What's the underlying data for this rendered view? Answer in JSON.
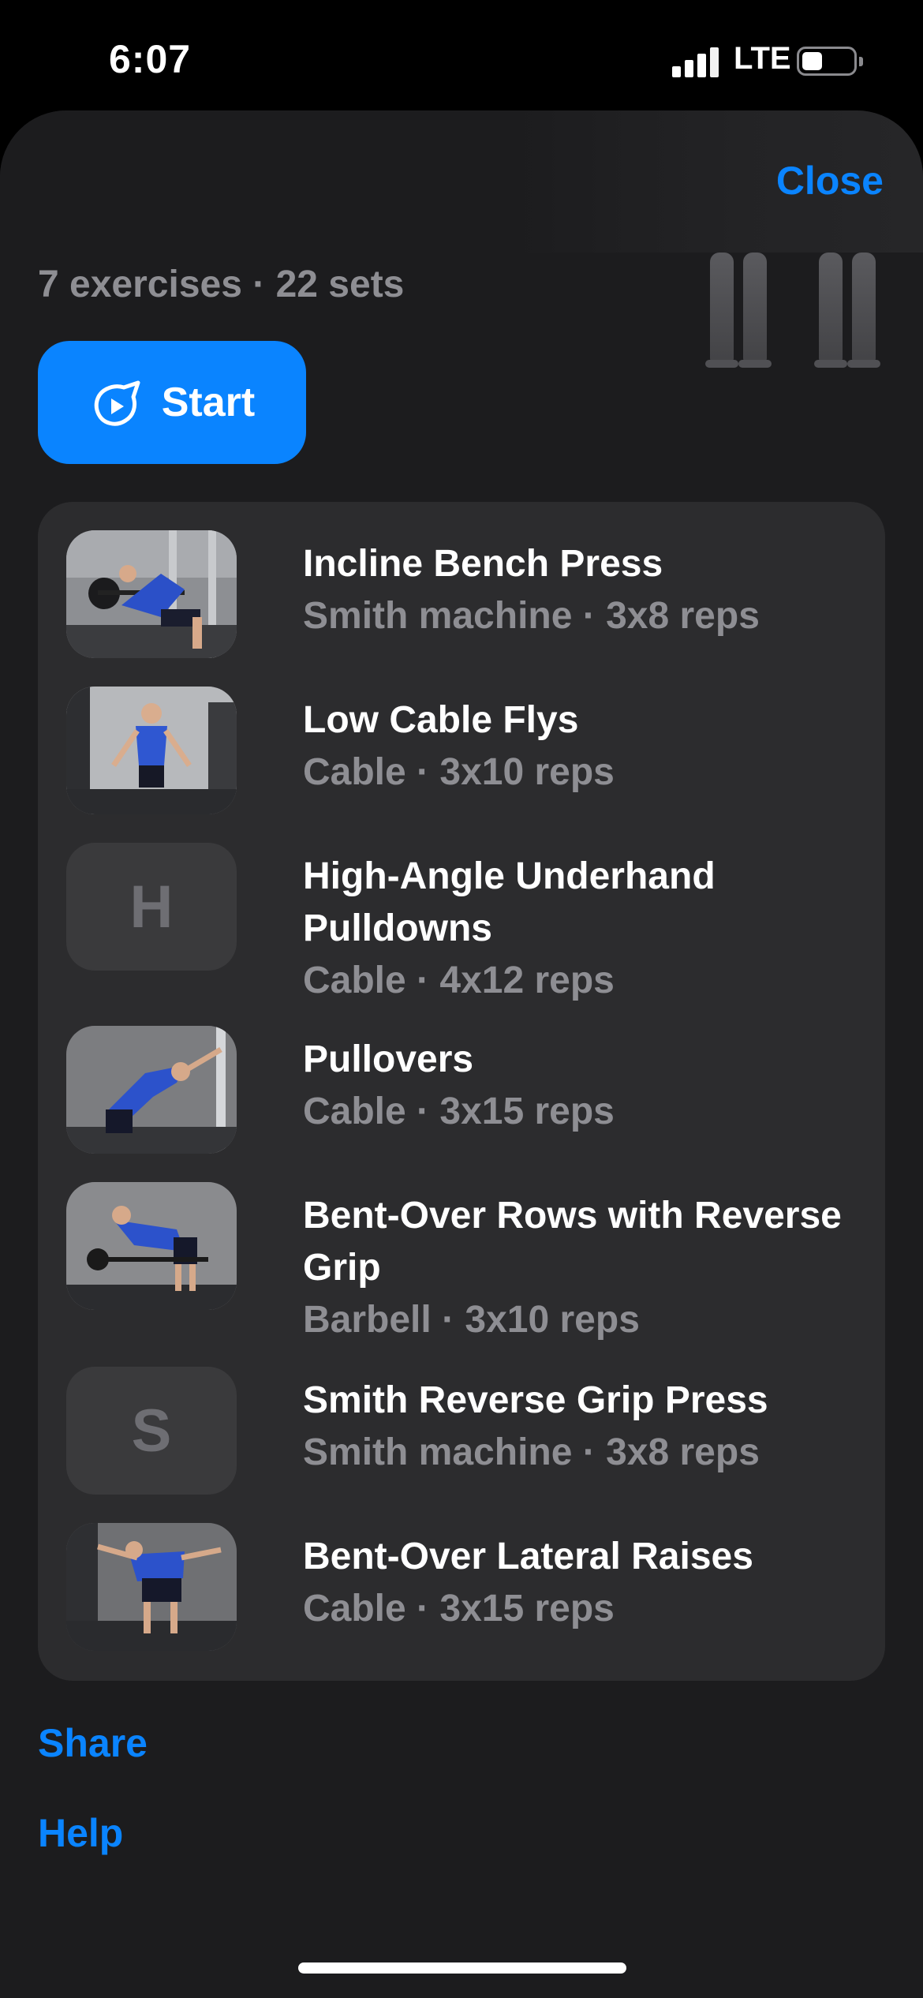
{
  "status_bar": {
    "time": "6:07",
    "network": "LTE",
    "battery_level": 0.35
  },
  "header": {
    "close_label": "Close"
  },
  "summary": "7 exercises · 22 sets",
  "start_label": "Start",
  "exercises": [
    {
      "name": "Incline Bench Press",
      "meta": "Smith machine · 3x8 reps",
      "thumb": "photo"
    },
    {
      "name": "Low Cable Flys",
      "meta": "Cable · 3x10 reps",
      "thumb": "photo"
    },
    {
      "name": "High-Angle Underhand Pulldowns",
      "meta": "Cable · 4x12 reps",
      "thumb": "letter",
      "letter": "H"
    },
    {
      "name": "Pullovers",
      "meta": "Cable · 3x15 reps",
      "thumb": "photo"
    },
    {
      "name": "Bent-Over Rows with Reverse Grip",
      "meta": "Barbell · 3x10 reps",
      "thumb": "photo"
    },
    {
      "name": "Smith Reverse Grip Press",
      "meta": "Smith machine · 3x8 reps",
      "thumb": "letter",
      "letter": "S"
    },
    {
      "name": "Bent-Over Lateral Raises",
      "meta": "Cable · 3x15 reps",
      "thumb": "photo"
    }
  ],
  "links": {
    "share": "Share",
    "help": "Help"
  },
  "colors": {
    "accent": "#0a84ff",
    "sheet": "#1c1c1e",
    "card": "#2c2c2e",
    "secondary_text": "#8e8e93"
  },
  "icons": [
    "signal-icon",
    "battery-icon",
    "start-rocket-icon",
    "muscle-map-icon"
  ]
}
